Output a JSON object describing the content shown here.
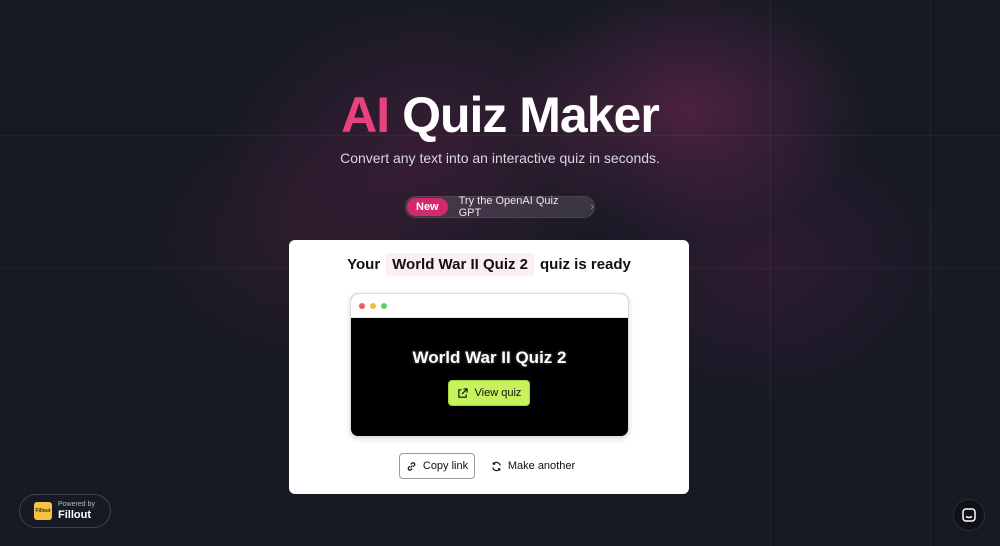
{
  "hero": {
    "title_accent": "AI",
    "title_rest": " Quiz Maker",
    "subtitle": "Convert any text into an interactive quiz in seconds."
  },
  "announcement": {
    "badge": "New",
    "text": "Try the OpenAI Quiz GPT",
    "chevron": "›"
  },
  "result_card": {
    "prefix": "Your",
    "quiz_name": "World War II Quiz 2",
    "suffix": "quiz is ready",
    "preview_title": "World War II Quiz 2",
    "view_button": "View quiz",
    "copy_button": "Copy link",
    "another_button": "Make another"
  },
  "footer": {
    "powered_small": "Powered by",
    "powered_brand": "Fillout",
    "logo_text": "Fillout"
  },
  "colors": {
    "accent": "#e8427e",
    "badge": "#d2296b",
    "view_button": "#c6f35b",
    "background": "#171a25"
  },
  "icons": {
    "copy": "link-icon",
    "another": "refresh-icon",
    "view": "external-link-icon",
    "chat": "chat-icon"
  }
}
